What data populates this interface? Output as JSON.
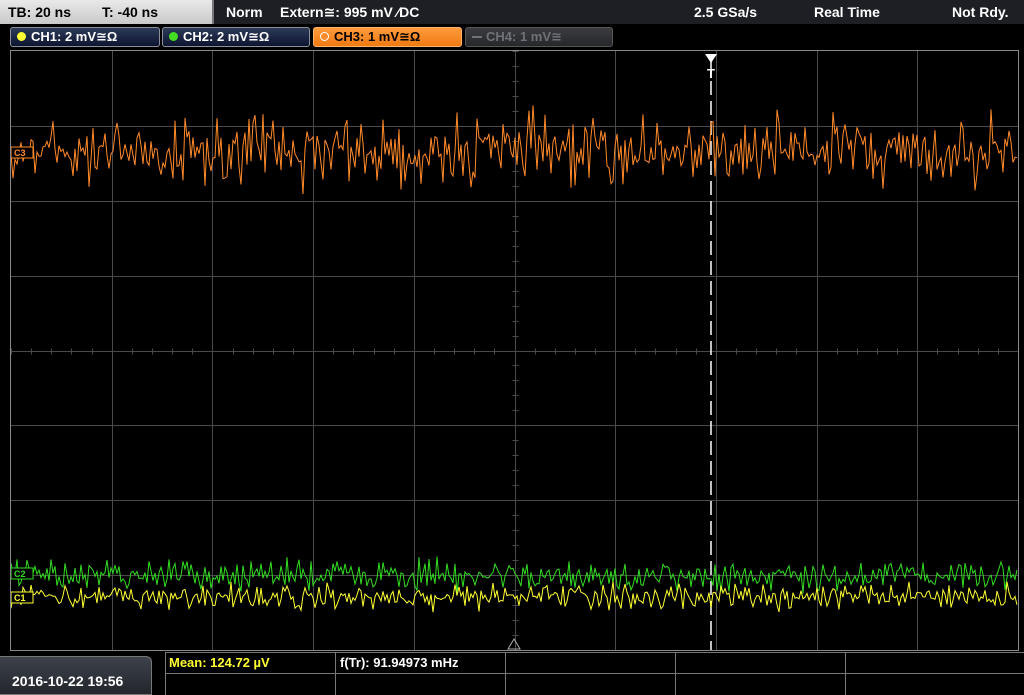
{
  "status_bar": {
    "timebase": "TB: 20 ns",
    "trigger_time": "T: -40 ns",
    "trigger_mode": "Norm",
    "trigger_source": "Extern≅: 995 mV ∕DC",
    "sample_rate": "2.5 GSa/s",
    "acquisition_mode": "Real Time",
    "status": "Not Rdy."
  },
  "channels": [
    {
      "label": "CH1: 2 mV≅Ω",
      "color": "#ffff33",
      "state": "on"
    },
    {
      "label": "CH2: 2 mV≅Ω",
      "color": "#44dd22",
      "state": "on"
    },
    {
      "label": "CH3: 1 mV≅Ω",
      "color": "#ff8a2a",
      "state": "active"
    },
    {
      "label": "CH4: 1 mV≅",
      "color": "#6f7278",
      "state": "off"
    }
  ],
  "markers": {
    "trigger_position": "T",
    "ch3_offset_marker": "C3",
    "ch2_offset_marker": "C2",
    "ch1_offset_marker": "C1"
  },
  "footer": {
    "datetime": "2016-10-22 19:56",
    "mean_measurement": "Mean: 124.72 µV",
    "freq_measurement": "f(Tr): 91.94973 mHz"
  },
  "colors": {
    "ch1": "#ffff33",
    "ch2": "#33dd22",
    "ch3": "#ff8a2a",
    "grid": "#4a4a4a",
    "mean_text": "#ffff33"
  }
}
